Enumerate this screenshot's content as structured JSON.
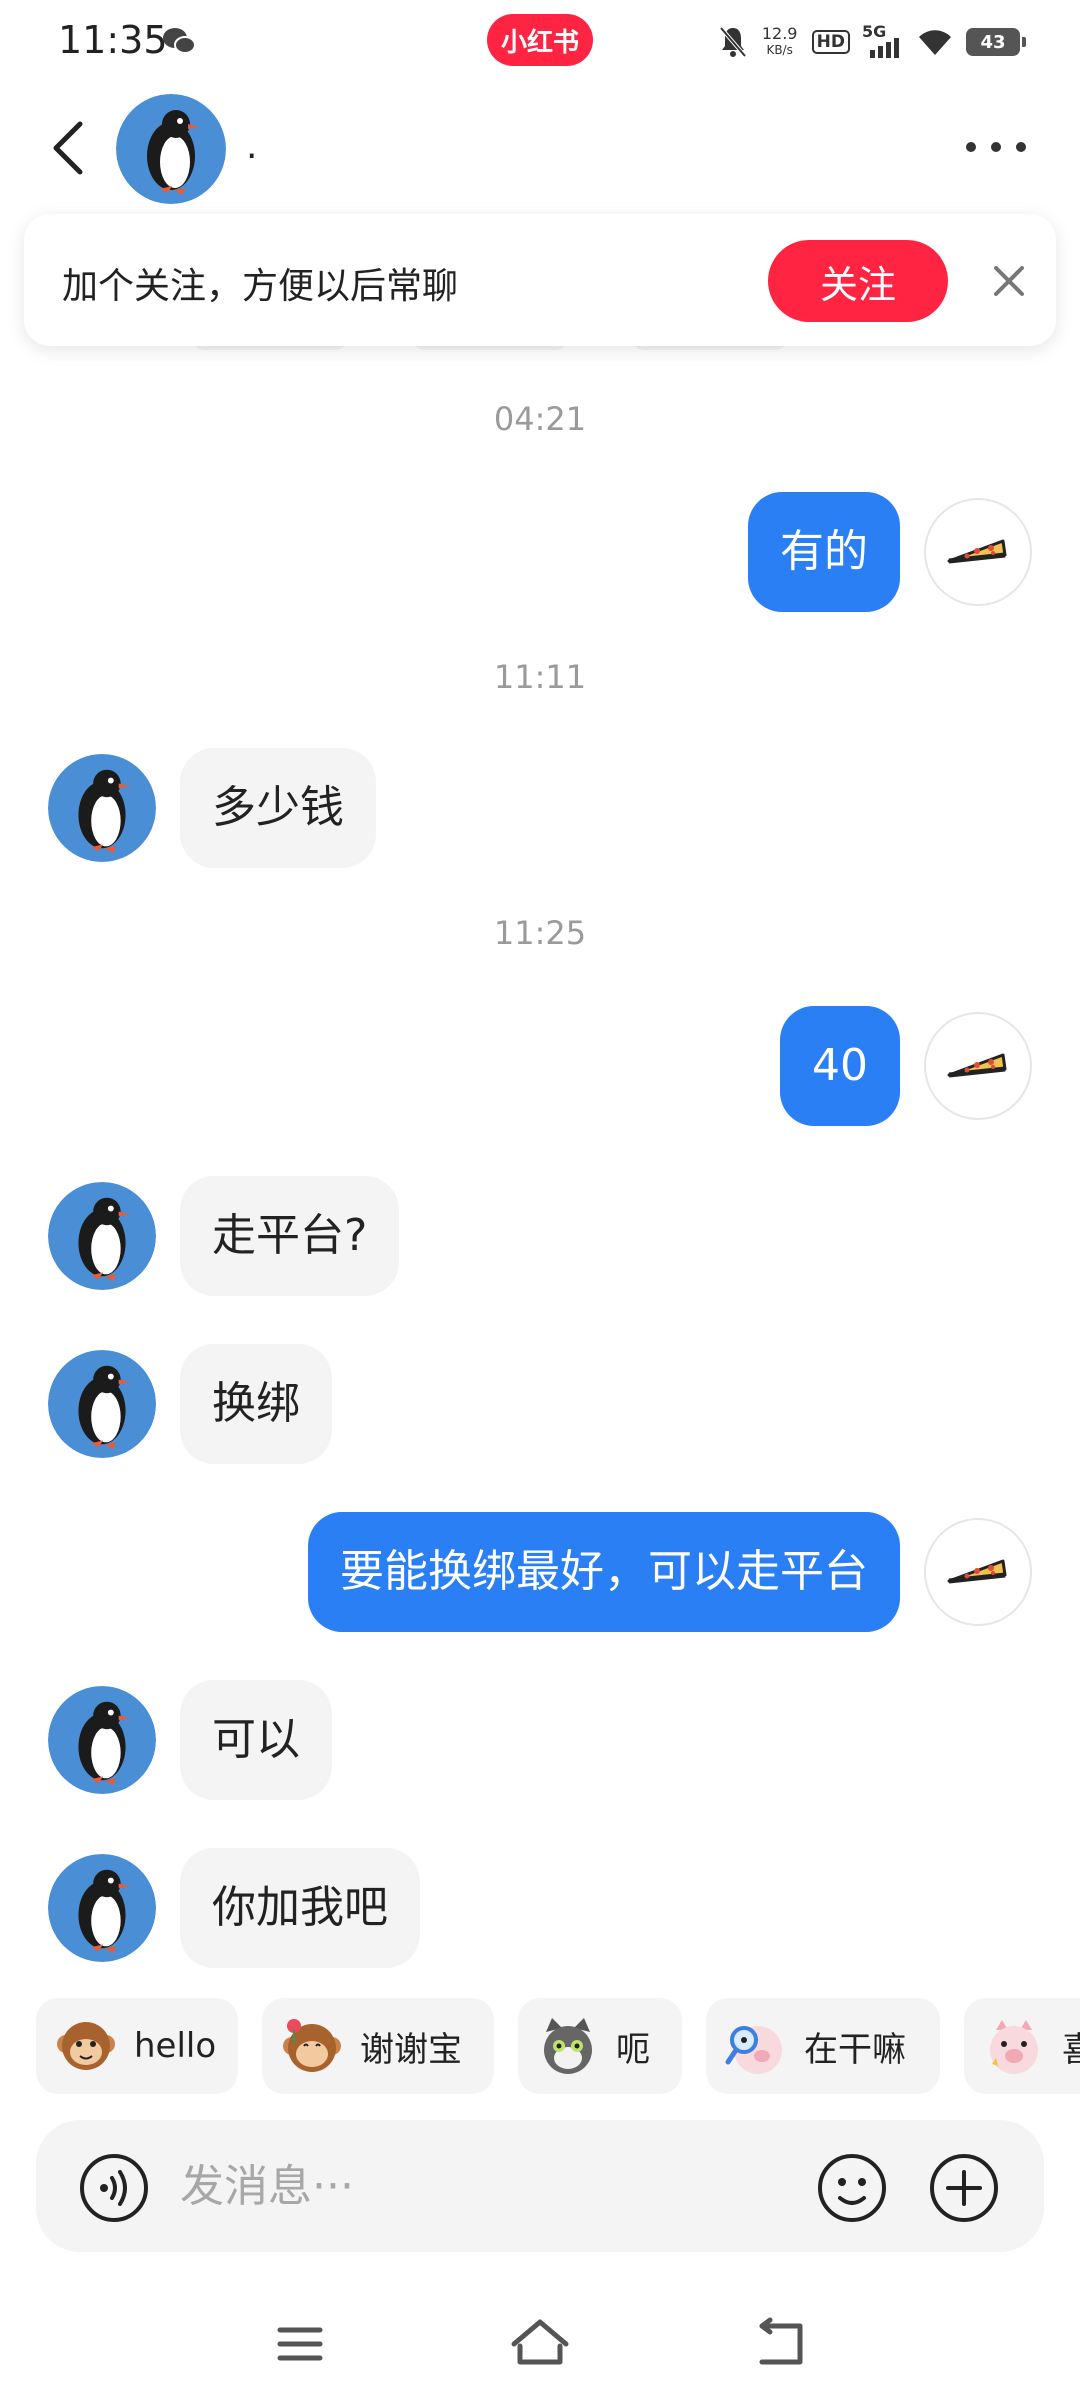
{
  "status_bar": {
    "time": "11:35",
    "app_badge": "小红书",
    "net_speed_value": "12.9",
    "net_speed_unit": "KB/s",
    "hd": "HD",
    "network": "5G",
    "battery": "43",
    "icons": [
      "wechat-icon",
      "mute-icon",
      "signal-icon",
      "wifi-icon",
      "battery-icon"
    ]
  },
  "header": {
    "contact_name": ".",
    "icons": [
      "back-icon",
      "more-icon"
    ]
  },
  "follow_banner": {
    "text": "加个关注，方便以后常聊",
    "button": "关注",
    "close_icon": "close-icon"
  },
  "messages": [
    {
      "type": "time",
      "text": "04:21"
    },
    {
      "type": "out",
      "text": "有的"
    },
    {
      "type": "time",
      "text": "11:11"
    },
    {
      "type": "in",
      "text": "多少钱"
    },
    {
      "type": "time",
      "text": "11:25"
    },
    {
      "type": "out",
      "text": "40"
    },
    {
      "type": "in",
      "text": "走平台?"
    },
    {
      "type": "in",
      "text": "换绑"
    },
    {
      "type": "out",
      "text": "要能换绑最好，可以走平台"
    },
    {
      "type": "in",
      "text": "可以"
    },
    {
      "type": "in",
      "text": "你加我吧"
    }
  ],
  "quick_replies": [
    {
      "label": "hello",
      "icon": "monkey-icon"
    },
    {
      "label": "谢谢宝",
      "icon": "monkey-flower-icon"
    },
    {
      "label": "呃",
      "icon": "cat-icon"
    },
    {
      "label": "在干嘛",
      "icon": "piggy-magnifier-icon"
    },
    {
      "label": "喜",
      "icon": "piggy-icon"
    }
  ],
  "input_bar": {
    "placeholder": "发消息···",
    "icons": [
      "voice-icon",
      "emoji-icon",
      "plus-icon"
    ]
  },
  "nav_bar": {
    "icons": [
      "menu-icon",
      "home-icon",
      "back-nav-icon"
    ]
  },
  "colors": {
    "brand_red": "#ff2442",
    "outgoing_bubble": "#2b7ff5",
    "incoming_bubble": "#f4f4f4",
    "avatar_blue": "#4a8fd6"
  }
}
